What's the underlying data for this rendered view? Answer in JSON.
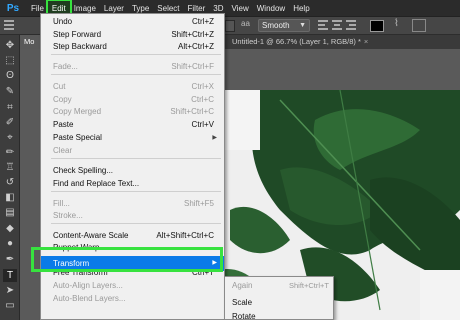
{
  "menubar": {
    "logo": "Ps",
    "items": [
      "File",
      "Edit",
      "Image",
      "Layer",
      "Type",
      "Select",
      "Filter",
      "3D",
      "View",
      "Window",
      "Help"
    ],
    "active_index": 1
  },
  "options_bar": {
    "antialias_icon": "aa",
    "antialias_value": "Smooth",
    "text_color": "#000000"
  },
  "tabs": {
    "first_label": "Mo",
    "doc_title": "Untitled-1 @ 66.7% (Layer 1, RGB/8) *",
    "close_glyph": "×"
  },
  "edit_menu": {
    "items": [
      {
        "label": "Undo",
        "shortcut": "Ctrl+Z",
        "enabled": true
      },
      {
        "label": "Step Forward",
        "shortcut": "Shift+Ctrl+Z",
        "enabled": true
      },
      {
        "label": "Step Backward",
        "shortcut": "Alt+Ctrl+Z",
        "enabled": true
      },
      {
        "label": "Fade...",
        "shortcut": "Shift+Ctrl+F",
        "enabled": false
      },
      {
        "label": "Cut",
        "shortcut": "Ctrl+X",
        "enabled": false
      },
      {
        "label": "Copy",
        "shortcut": "Ctrl+C",
        "enabled": false
      },
      {
        "label": "Copy Merged",
        "shortcut": "Shift+Ctrl+C",
        "enabled": false
      },
      {
        "label": "Paste",
        "shortcut": "Ctrl+V",
        "enabled": true
      },
      {
        "label": "Paste Special",
        "shortcut": "",
        "enabled": true,
        "submenu": true
      },
      {
        "label": "Clear",
        "shortcut": "",
        "enabled": false
      },
      {
        "label": "Check Spelling...",
        "shortcut": "",
        "enabled": true
      },
      {
        "label": "Find and Replace Text...",
        "shortcut": "",
        "enabled": true
      },
      {
        "label": "Fill...",
        "shortcut": "Shift+F5",
        "enabled": false
      },
      {
        "label": "Stroke...",
        "shortcut": "",
        "enabled": false
      },
      {
        "label": "Content-Aware Scale",
        "shortcut": "Alt+Shift+Ctrl+C",
        "enabled": true
      },
      {
        "label": "Puppet Warp",
        "shortcut": "",
        "enabled": true
      },
      {
        "label": "Perspective Warp",
        "shortcut": "",
        "enabled": true
      },
      {
        "label": "Free Transform",
        "shortcut": "Ctrl+T",
        "enabled": true
      },
      {
        "label": "Transform",
        "shortcut": "",
        "enabled": true,
        "submenu": true,
        "highlighted": true
      },
      {
        "label": "Auto-Align Layers...",
        "shortcut": "",
        "enabled": false
      },
      {
        "label": "Auto-Blend Layers...",
        "shortcut": "",
        "enabled": false
      }
    ],
    "submenu_arrow": "▶"
  },
  "transform_submenu": {
    "items": [
      {
        "label": "Again",
        "shortcut": "Shift+Ctrl+T",
        "enabled": false
      },
      {
        "label": "Scale",
        "shortcut": "",
        "enabled": true
      },
      {
        "label": "Rotate",
        "shortcut": "",
        "enabled": true
      }
    ]
  },
  "colors": {
    "highlight": "#0a7be8",
    "callout": "#37e23f"
  },
  "icons": {
    "tools": [
      "move-icon",
      "marquee-icon",
      "lasso-icon",
      "quick-select-icon",
      "crop-icon",
      "eyedropper-icon",
      "healing-icon",
      "brush-icon",
      "stamp-icon",
      "history-brush-icon",
      "eraser-icon",
      "gradient-icon",
      "blur-icon",
      "dodge-icon",
      "pen-icon",
      "type-icon",
      "path-select-icon",
      "shape-icon"
    ]
  }
}
